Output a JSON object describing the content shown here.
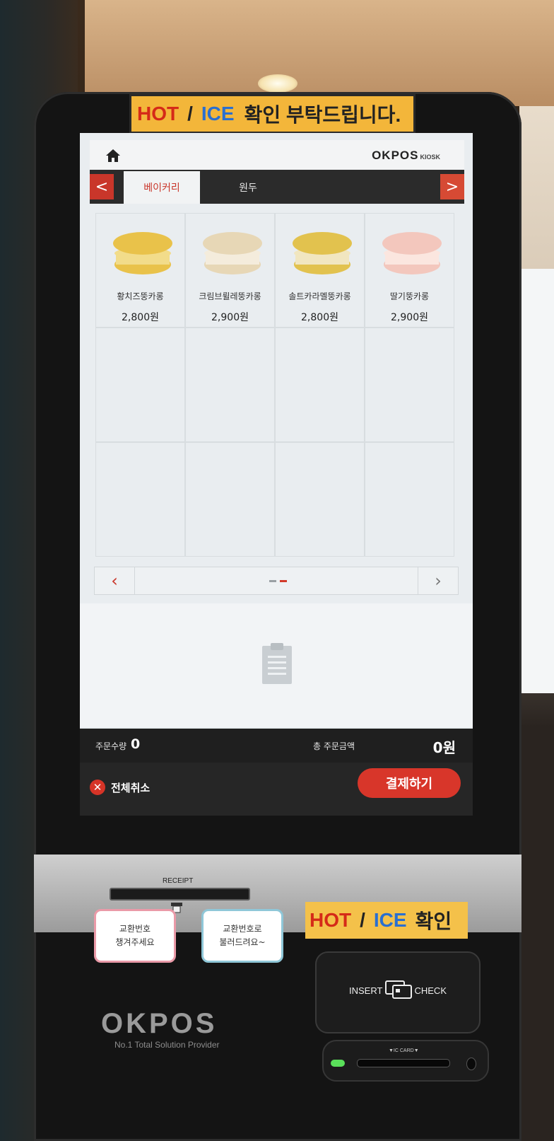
{
  "top_sign": {
    "hot": "HOT",
    "slash": "/",
    "ice": "ICE",
    "rest": "확인 부탁드립니다."
  },
  "header": {
    "brand": "OKPOS",
    "brand_sub": "KIOSK"
  },
  "tabs": {
    "prev": "<",
    "next": ">",
    "items": [
      {
        "label": "베이커리"
      },
      {
        "label": "원두"
      }
    ]
  },
  "products": [
    {
      "name": "황치즈뚱카롱",
      "price": "2,800원",
      "colors": [
        "#e9c24a",
        "#f2dc8a"
      ]
    },
    {
      "name": "크림브륄레뚱카롱",
      "price": "2,900원",
      "colors": [
        "#e7d7b6",
        "#f4ecdc"
      ]
    },
    {
      "name": "솔트카라멜뚱카롱",
      "price": "2,800원",
      "colors": [
        "#e2c24e",
        "#f1e6c0"
      ]
    },
    {
      "name": "딸기뚱카롱",
      "price": "2,900원",
      "colors": [
        "#f3c7bd",
        "#fbe6df"
      ]
    }
  ],
  "pager": {
    "prev": "‹",
    "next": "›"
  },
  "summary": {
    "qty_label": "주문수량",
    "qty_value": "0",
    "total_label": "총 주문금액",
    "total_value": "0원"
  },
  "actions": {
    "cancel": "전체취소",
    "cancel_icon": "✕",
    "pay": "결제하기"
  },
  "hardware": {
    "receipt_label": "RECEIPT",
    "note_pink": [
      "교환번호",
      "챙겨주세요"
    ],
    "note_blue": [
      "교환번호로",
      "불러드려요~"
    ],
    "sign2": {
      "hot": "HOT",
      "slash": "/",
      "ice": "ICE",
      "rest": "확인"
    },
    "card_insert": "INSERT",
    "card_check": "CHECK",
    "ic_label": "▼IC CARD▼",
    "logo": "OKPOS",
    "tagline": "No.1 Total Solution Provider"
  },
  "colors": {
    "accent": "#d8362a",
    "screen_bg": "#e9edf0"
  }
}
